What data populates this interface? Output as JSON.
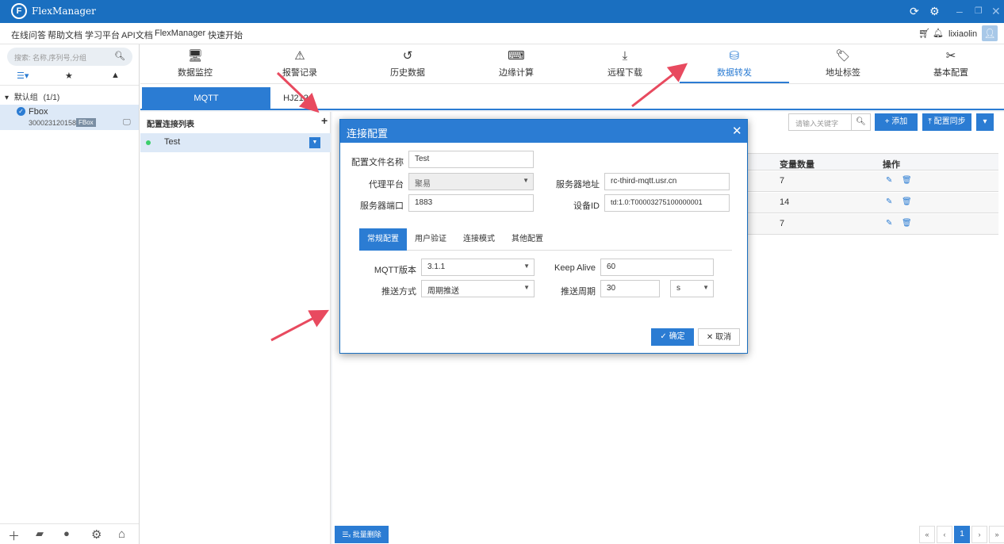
{
  "titlebar": {
    "title": "FlexManager",
    "logo_letter": "F",
    "icons": [
      "refresh-icon",
      "gear-icon",
      "minimize-icon",
      "restore-icon",
      "close-icon"
    ]
  },
  "menubar": {
    "items": [
      "在线问答",
      "帮助文档",
      "学习平台",
      "API文档",
      "FlexManager",
      "快速开始"
    ],
    "username": "lixiaolin"
  },
  "sidebar": {
    "search_placeholder": "搜索: 名称,序列号,分组",
    "group_label": "默认组",
    "group_count": "(1/1)",
    "device": {
      "name": "Fbox",
      "serial": "300023120158",
      "badge": "FBox"
    }
  },
  "toolbar": {
    "items": [
      {
        "label": "数据监控",
        "icon": "monitor-icon"
      },
      {
        "label": "报警记录",
        "icon": "alarm-icon"
      },
      {
        "label": "历史数据",
        "icon": "history-icon"
      },
      {
        "label": "边缘计算",
        "icon": "code-icon"
      },
      {
        "label": "远程下载",
        "icon": "download-icon"
      },
      {
        "label": "数据转发",
        "icon": "database-forward-icon",
        "active": true
      },
      {
        "label": "地址标签",
        "icon": "tag-icon"
      },
      {
        "label": "基本配置",
        "icon": "tools-icon"
      }
    ]
  },
  "protocol_tabs": {
    "mqtt": "MQTT",
    "hj212": "HJ212"
  },
  "config_list": {
    "title": "配置连接列表",
    "add": "+",
    "items": [
      {
        "name": "Test"
      }
    ]
  },
  "right_panel": {
    "keyword_placeholder": "请输入关键字",
    "add_button": "+ 添加",
    "sync_button": "配置同步",
    "columns": {
      "var_count": "变量数量",
      "actions": "操作"
    },
    "rows": [
      {
        "var_count": "7"
      },
      {
        "var_count": "14"
      },
      {
        "var_count": "7"
      }
    ],
    "batch_delete": "批量删除",
    "current_page": "1"
  },
  "dialog": {
    "title": "连接配置",
    "fields": {
      "config_name_label": "配置文件名称",
      "config_name_value": "Test",
      "proxy_platform_label": "代理平台",
      "proxy_platform_value": "聚易",
      "server_port_label": "服务器端口",
      "server_port_value": "1883",
      "server_address_label": "服务器地址",
      "server_address_value": "rc-third-mqtt.usr.cn",
      "device_id_label": "设备ID",
      "device_id_value": "td:1.0:T00003275100000001"
    },
    "tabs": [
      "常规配置",
      "用户验证",
      "连接模式",
      "其他配置"
    ],
    "general": {
      "mqtt_version_label": "MQTT版本",
      "mqtt_version_value": "3.1.1",
      "push_mode_label": "推送方式",
      "push_mode_value": "周期推送",
      "keep_alive_label": "Keep Alive",
      "keep_alive_value": "60",
      "push_period_label": "推送周期",
      "push_period_value": "30",
      "push_unit_value": "s"
    },
    "ok_button": "确定",
    "cancel_button": "取消"
  },
  "colors": {
    "brand_blue": "#1a6fc0",
    "accent_blue": "#2b7cd3",
    "arrow_red": "#e84a5f",
    "online_green": "#3ccf6b"
  }
}
